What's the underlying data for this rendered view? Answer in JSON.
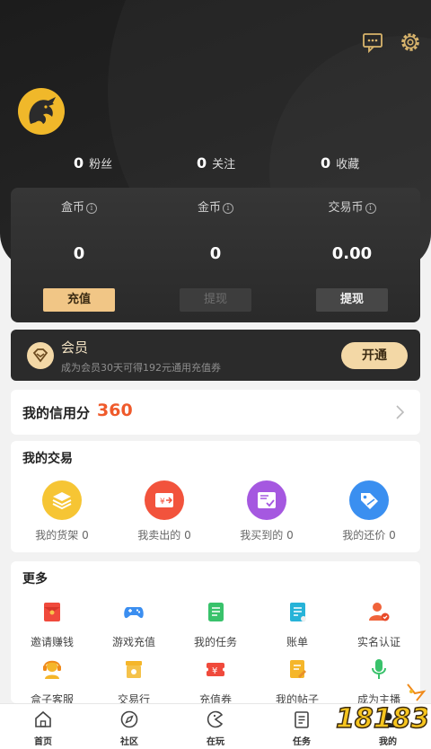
{
  "stats": [
    {
      "value": "0",
      "label": "粉丝"
    },
    {
      "value": "0",
      "label": "关注"
    },
    {
      "value": "0",
      "label": "收藏"
    }
  ],
  "wallet": [
    {
      "label": "盒币",
      "value": "0",
      "button": "充值"
    },
    {
      "label": "金币",
      "value": "0",
      "button": "提现"
    },
    {
      "label": "交易币",
      "value": "0.00",
      "button": "提现"
    }
  ],
  "member": {
    "title": "会员",
    "desc": "成为会员30天可得192元通用充值券",
    "button": "开通"
  },
  "credit": {
    "label": "我的信用分",
    "score": "360"
  },
  "trade": {
    "title": "我的交易",
    "items": [
      {
        "label": "我的货架 0",
        "color": "#f6c534"
      },
      {
        "label": "我卖出的 0",
        "color": "#f2533c"
      },
      {
        "label": "我买到的 0",
        "color": "#a558e0"
      },
      {
        "label": "我的还价 0",
        "color": "#3a8ff0"
      }
    ]
  },
  "more": {
    "title": "更多",
    "row1": [
      "邀请赚钱",
      "游戏充值",
      "我的任务",
      "账单",
      "实名认证"
    ],
    "row2": [
      "盒子客服",
      "交易行",
      "充值券",
      "我的帖子",
      "成为主播"
    ]
  },
  "tabs": [
    "首页",
    "社区",
    "在玩",
    "任务",
    "我的"
  ],
  "colors": {
    "gold": "#f1c686",
    "accent": "#ef5a2b",
    "dark": "#1e1e1e"
  },
  "watermark": "18183"
}
